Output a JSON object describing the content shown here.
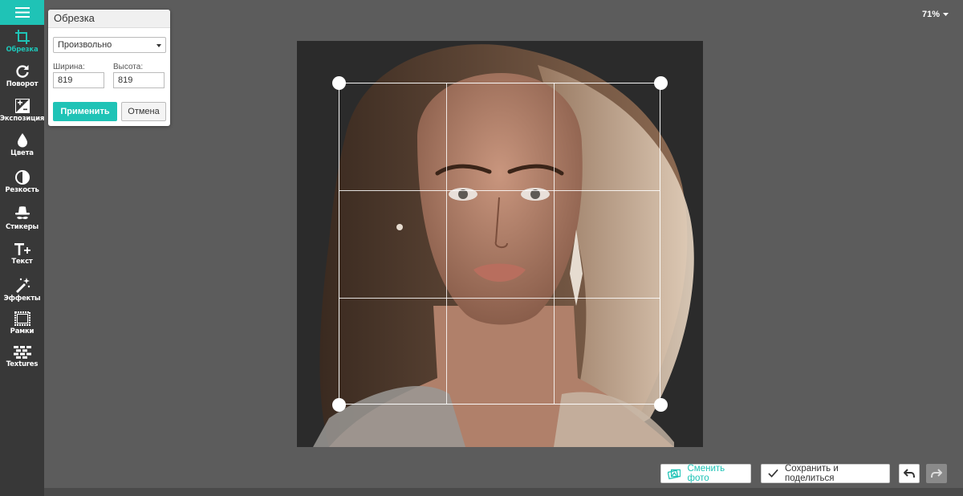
{
  "sidebar": {
    "menu_icon": "hamburger-icon",
    "tools": [
      {
        "label": "Обрезка",
        "icon": "crop-icon",
        "active": true
      },
      {
        "label": "Поворот",
        "icon": "rotate-icon"
      },
      {
        "label": "Экспозиция",
        "icon": "exposure-icon"
      },
      {
        "label": "Цвета",
        "icon": "drop-icon"
      },
      {
        "label": "Резкость",
        "icon": "half-circle-icon"
      },
      {
        "label": "Стикеры",
        "icon": "hat-mustache-icon"
      },
      {
        "label": "Текст",
        "icon": "text-plus-icon"
      },
      {
        "label": "Эффекты",
        "icon": "magic-wand-icon"
      },
      {
        "label": "Рамки",
        "icon": "frame-icon"
      },
      {
        "label": "Textures",
        "icon": "texture-icon"
      }
    ]
  },
  "zoom": {
    "label": "71%"
  },
  "crop_panel": {
    "title": "Обрезка",
    "ratio_select": "Произвольно",
    "width_label": "Ширина:",
    "width_value": "819",
    "height_label": "Высота:",
    "height_value": "819",
    "apply_label": "Применить",
    "cancel_label": "Отмена"
  },
  "actions": {
    "change_photo_label": "Сменить фото",
    "save_share_label": "Сохранить и поделиться"
  },
  "colors": {
    "accent": "#1fc3b6",
    "sidebar_bg": "#383838",
    "workspace_bg": "#5c5c5c"
  }
}
